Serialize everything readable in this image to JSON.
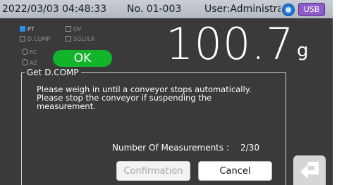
{
  "status_bar": {
    "datetime": "2022/03/03 04:48:33",
    "number": "No. 01-003",
    "user": "User:Administrato",
    "usb_label": "USB",
    "network_icon": "network-icon"
  },
  "indicators": {
    "pt": "PT",
    "ov": "OV",
    "dcomp": "D.COMP",
    "sgl_ilk": "SGL/ILK",
    "fc": "FC",
    "az": "AZ"
  },
  "judgement": "OK",
  "weight": {
    "value": "100.7",
    "unit": "g"
  },
  "panel": {
    "title": "Get D.COMP",
    "message": "Please weigh in until a conveyor stops automatically.\nPlease stop the conveyor if suspending the\nmeasurement.",
    "measurements_label": "Number Of Measurements :",
    "measurements_value": "2/30"
  },
  "buttons": {
    "confirmation": "Confirmation",
    "cancel": "Cancel",
    "back_icon": "return-arrow-icon"
  },
  "colors": {
    "background": "#3a3a3a",
    "ok": "#12b52a",
    "pt_active": "#2e8be6",
    "usb": "#8d5cc9"
  }
}
